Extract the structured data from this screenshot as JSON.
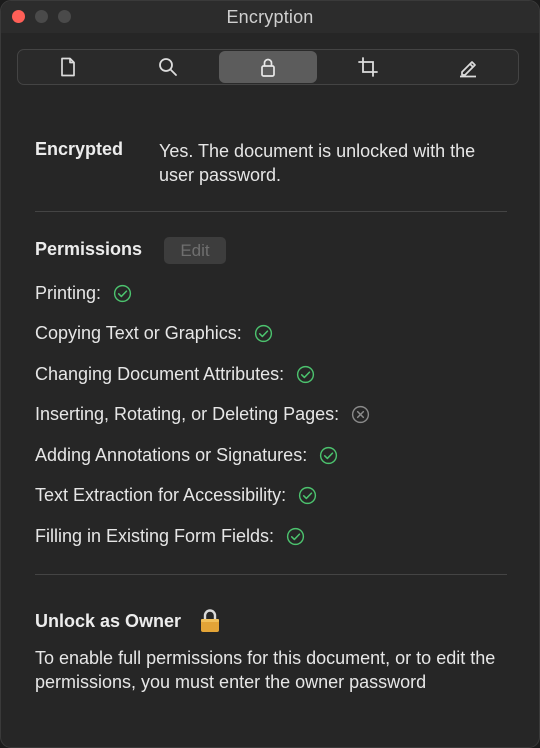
{
  "window": {
    "title": "Encryption"
  },
  "toolbar": {
    "tabs": [
      {
        "icon": "document-icon",
        "active": false
      },
      {
        "icon": "search-icon",
        "active": false
      },
      {
        "icon": "lock-icon",
        "active": true
      },
      {
        "icon": "crop-icon",
        "active": false
      },
      {
        "icon": "pencil-icon",
        "active": false
      }
    ]
  },
  "encryption": {
    "label": "Encrypted",
    "value": "Yes. The document is unlocked with the user password."
  },
  "permissions": {
    "title": "Permissions",
    "edit_label": "Edit",
    "items": [
      {
        "label": "Printing:",
        "allowed": true
      },
      {
        "label": "Copying Text or Graphics:",
        "allowed": true
      },
      {
        "label": "Changing Document Attributes:",
        "allowed": true
      },
      {
        "label": "Inserting, Rotating, or Deleting Pages:",
        "allowed": false
      },
      {
        "label": "Adding Annotations or Signatures:",
        "allowed": true
      },
      {
        "label": "Text Extraction for Accessibility:",
        "allowed": true
      },
      {
        "label": "Filling in Existing Form Fields:",
        "allowed": true
      }
    ]
  },
  "owner": {
    "title": "Unlock as Owner",
    "description": "To enable full permissions for this document, or to edit the permissions, you must enter the owner password"
  },
  "colors": {
    "allowed": "#4cc36e",
    "denied": "#8a8a8a",
    "accent_active_tab": "#5c5c5c",
    "lock_gold": "#e3a437"
  }
}
